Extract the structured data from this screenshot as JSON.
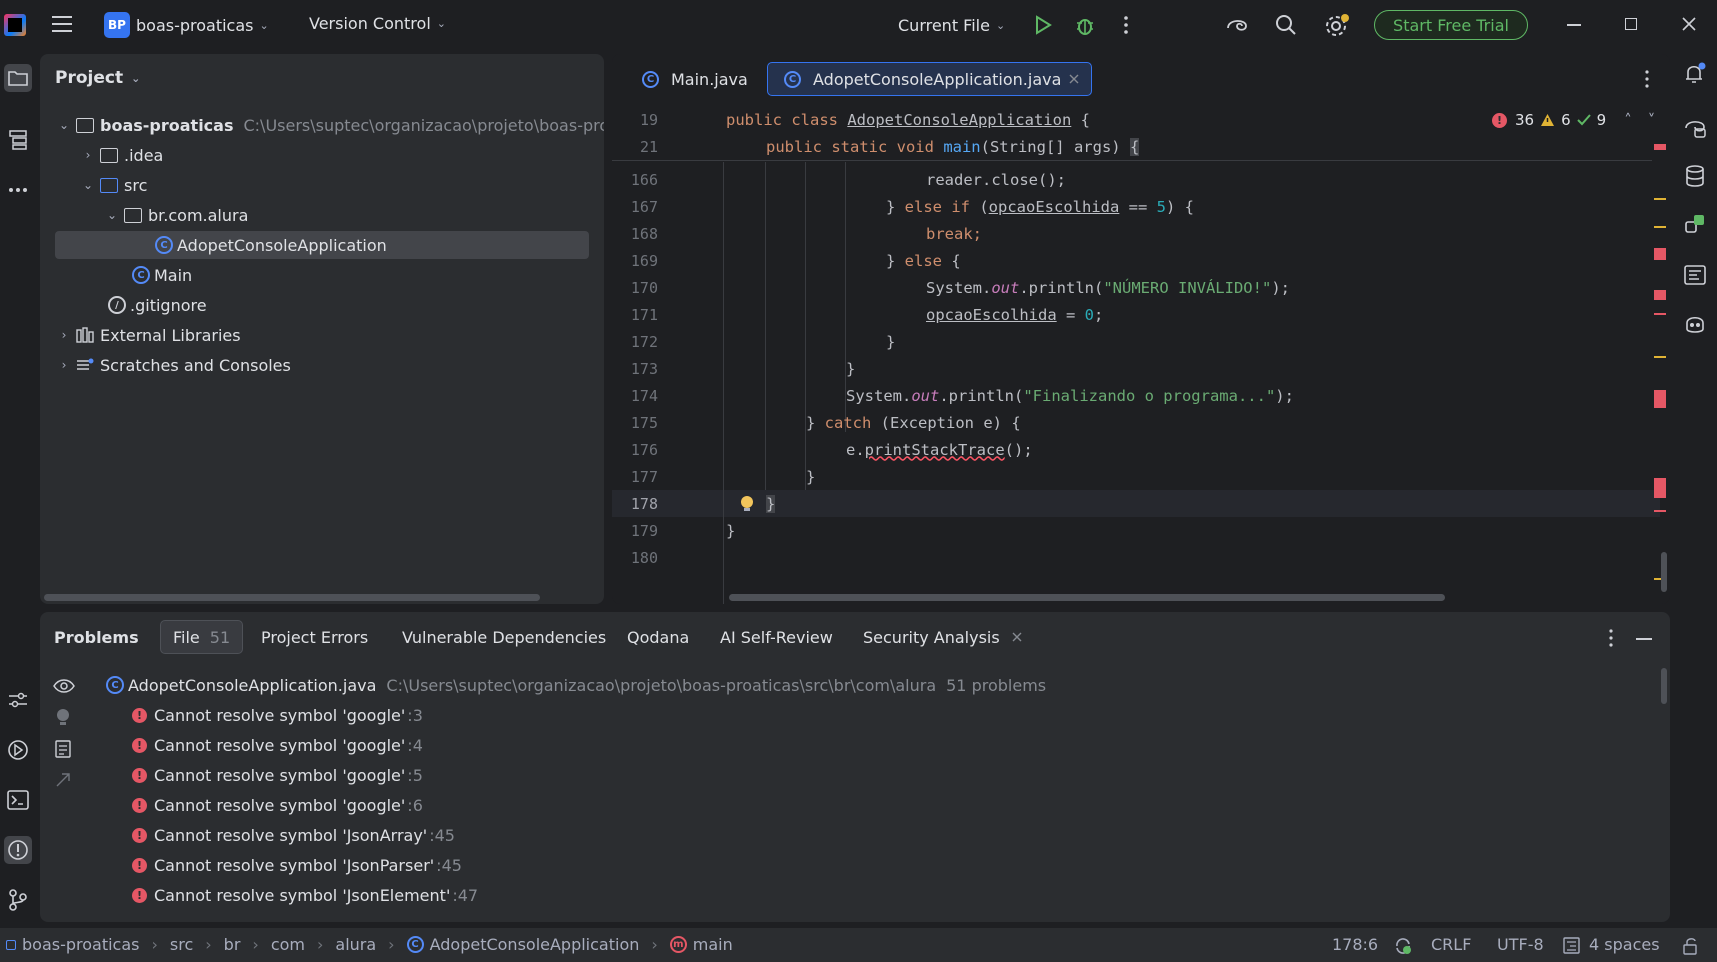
{
  "titlebar": {
    "project_badge": "BP",
    "project_name": "boas-proaticas",
    "vcs_label": "Version Control",
    "run_config": "Current File",
    "trial_button": "Start Free Trial"
  },
  "project_panel": {
    "title": "Project",
    "root": "boas-proaticas",
    "root_path": "C:\\Users\\suptec\\organizacao\\projeto\\boas-pro",
    "items": [
      {
        "label": ".idea"
      },
      {
        "label": "src"
      },
      {
        "label": "br.com.alura"
      },
      {
        "label": "AdopetConsoleApplication"
      },
      {
        "label": "Main"
      },
      {
        "label": ".gitignore"
      },
      {
        "label": "External Libraries"
      },
      {
        "label": "Scratches and Consoles"
      }
    ]
  },
  "editor": {
    "tabs": [
      {
        "label": "Main.java"
      },
      {
        "label": "AdopetConsoleApplication.java"
      }
    ],
    "inspections": {
      "errors": "36",
      "warnings": "6",
      "ok": "9"
    },
    "sticky": [
      {
        "num": "19",
        "code": "public class AdopetConsoleApplication {"
      },
      {
        "num": "21",
        "code": "    public static void main(String[] args) {"
      }
    ],
    "lines": [
      {
        "num": "166"
      },
      {
        "num": "167"
      },
      {
        "num": "168"
      },
      {
        "num": "169"
      },
      {
        "num": "170"
      },
      {
        "num": "171"
      },
      {
        "num": "172"
      },
      {
        "num": "173"
      },
      {
        "num": "174"
      },
      {
        "num": "175"
      },
      {
        "num": "176"
      },
      {
        "num": "177"
      },
      {
        "num": "178"
      },
      {
        "num": "179"
      },
      {
        "num": "180"
      }
    ],
    "code_text": {
      "l166": "reader.close();",
      "l167a": "} ",
      "l167kw": "else if",
      "l167b": " (",
      "l167var": "opcaoEscolhida",
      "l167c": " == ",
      "l167num": "5",
      "l167d": ") {",
      "l168": "break;",
      "l169a": "} ",
      "l169kw": "else",
      "l169b": " {",
      "l170a": "System.",
      "l170out": "out",
      "l170b": ".println(",
      "l170str": "\"NÚMERO INVÁLIDO!\"",
      "l170c": ");",
      "l171var": "opcaoEscolhida",
      "l171a": " = ",
      "l171num": "0",
      "l171b": ";",
      "l172": "}",
      "l173": "}",
      "l174a": "System.",
      "l174out": "out",
      "l174b": ".println(",
      "l174str": "\"Finalizando o programa...\"",
      "l174c": ");",
      "l175a": "} ",
      "l175kw": "catch",
      "l175b": " (Exception e) {",
      "l176a": "e.",
      "l176fn": "printStackTrace",
      "l176b": "();",
      "l177": "}",
      "l178": "}",
      "l179": "}"
    }
  },
  "problems": {
    "tabs": [
      {
        "label": "Problems"
      },
      {
        "label": "File",
        "count": "51"
      },
      {
        "label": "Project Errors"
      },
      {
        "label": "Vulnerable Dependencies"
      },
      {
        "label": "Qodana"
      },
      {
        "label": "AI Self-Review"
      },
      {
        "label": "Security Analysis"
      }
    ],
    "file_name": "AdopetConsoleApplication.java",
    "file_path": "C:\\Users\\suptec\\organizacao\\projeto\\boas-proaticas\\src\\br\\com\\alura",
    "file_count": "51 problems",
    "items": [
      {
        "message": "Cannot resolve symbol 'google'",
        "line": ":3"
      },
      {
        "message": "Cannot resolve symbol 'google'",
        "line": ":4"
      },
      {
        "message": "Cannot resolve symbol 'google'",
        "line": ":5"
      },
      {
        "message": "Cannot resolve symbol 'google'",
        "line": ":6"
      },
      {
        "message": "Cannot resolve symbol 'JsonArray'",
        "line": ":45"
      },
      {
        "message": "Cannot resolve symbol 'JsonParser'",
        "line": ":45"
      },
      {
        "message": "Cannot resolve symbol 'JsonElement'",
        "line": ":47"
      }
    ]
  },
  "statusbar": {
    "crumbs": [
      "boas-proaticas",
      "src",
      "br",
      "com",
      "alura",
      "AdopetConsoleApplication",
      "main"
    ],
    "position": "178:6",
    "line_sep": "CRLF",
    "encoding": "UTF-8",
    "indent": "4 spaces"
  },
  "colors": {
    "accent": "#3574f0",
    "error": "#e55765",
    "warning": "#e0b335",
    "success": "#5fb865"
  }
}
